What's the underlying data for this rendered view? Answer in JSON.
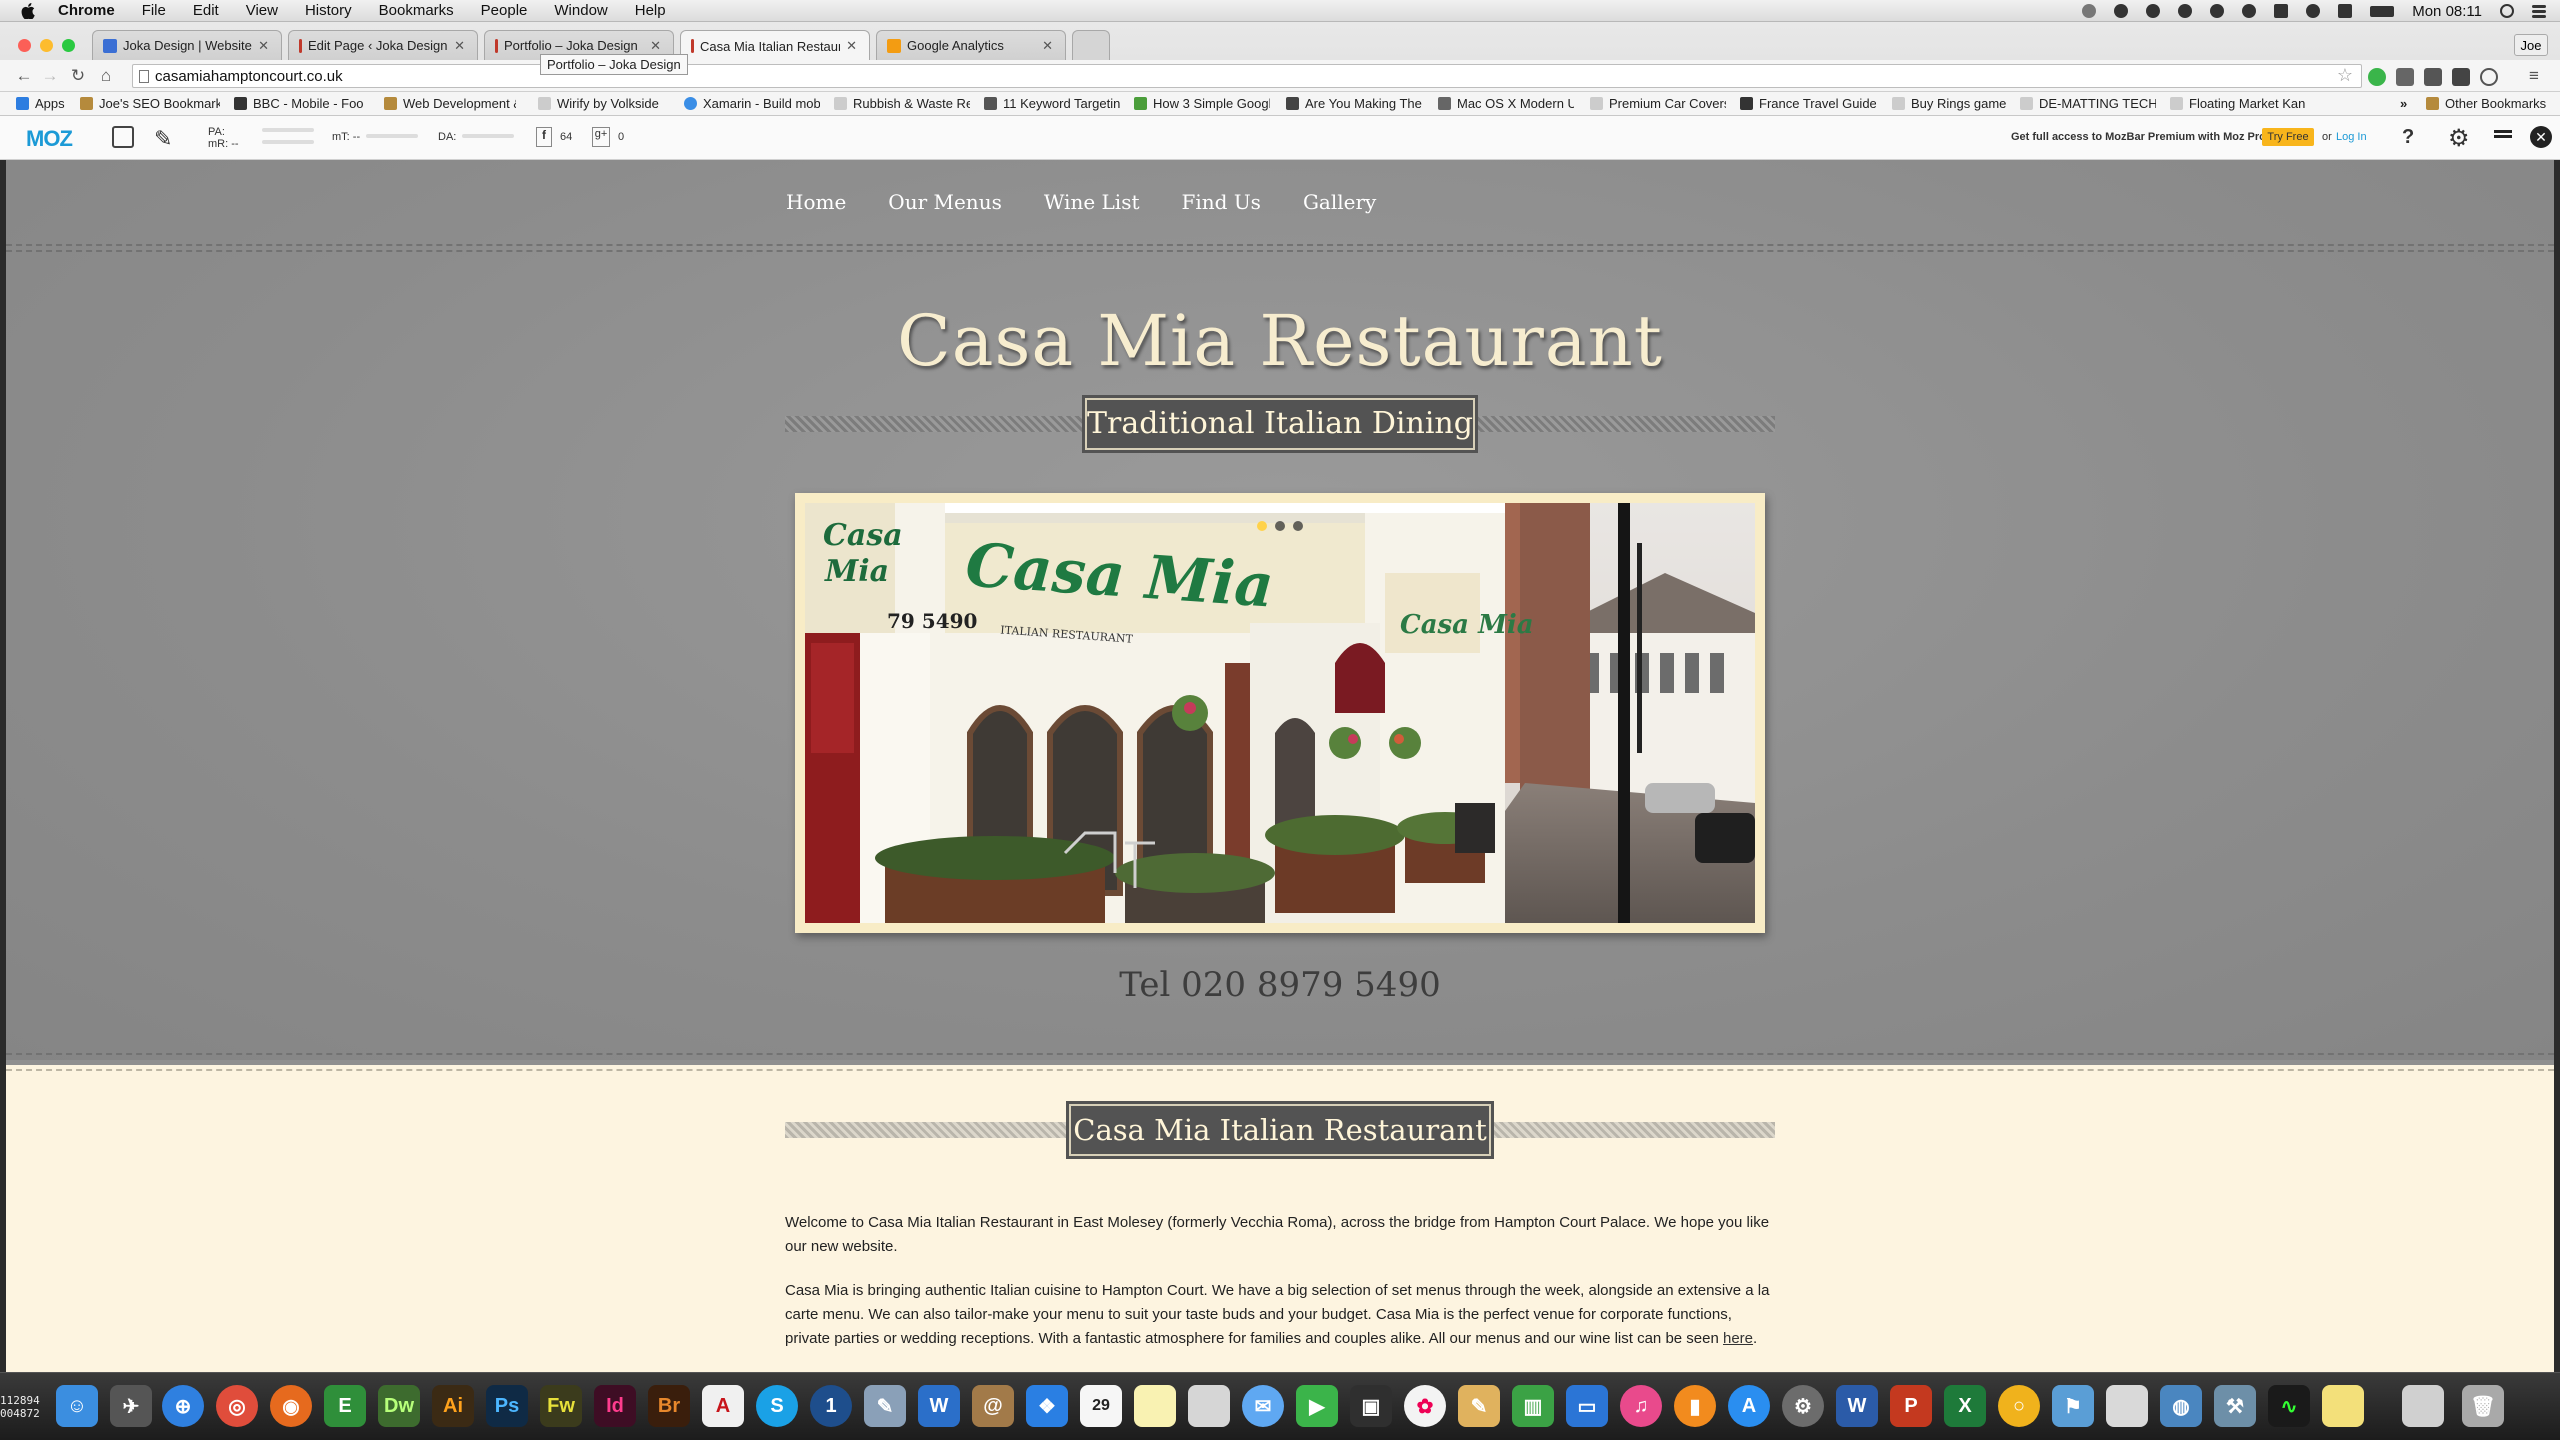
{
  "menubar": {
    "app": "Chrome",
    "items": [
      "File",
      "Edit",
      "View",
      "History",
      "Bookmarks",
      "People",
      "Window",
      "Help"
    ],
    "clock": "Mon 08:11"
  },
  "tabs": [
    {
      "title": "Joka Design | Website Des",
      "fav": "#3b6fd4"
    },
    {
      "title": "Edit Page ‹ Joka Design —",
      "fav": "#c0392b"
    },
    {
      "title": "Portfolio – Joka Design",
      "fav": "#c0392b"
    },
    {
      "title": "Casa Mia Italian Restaurant",
      "fav": "#c0392b"
    },
    {
      "title": "Google Analytics",
      "fav": "#f39c12"
    }
  ],
  "tooltip": "Portfolio – Joka Design",
  "user": "Joe",
  "url": "casamiahamptoncourt.co.uk",
  "bookmarks": [
    "Apps",
    "Joe's SEO Bookmark",
    "BBC - Mobile - Food",
    "Web Development &",
    "Wirify by Volkside",
    "Xamarin - Build mob",
    "Rubbish & Waste Re",
    "11 Keyword Targetin",
    "How 3 Simple Googl",
    "Are You Making The",
    "Mac OS X Modern U",
    "Premium Car Covers",
    "France Travel Guide",
    "Buy Rings game",
    "DE-MATTING TECHN",
    "Floating Market Kan"
  ],
  "other_bookmarks": "Other Bookmarks",
  "mozbar": {
    "logo": "MOZ",
    "pa": "PA:",
    "mr": "mR: --",
    "mt": "mT: --",
    "da": "DA:",
    "fb": "64",
    "gp": "0",
    "promo": "Get full access to MozBar Premium with Moz Pro",
    "try": "Try Free",
    "or": "or",
    "login": "Log In"
  },
  "site": {
    "nav": [
      "Home",
      "Our Menus",
      "Wine List",
      "Find Us",
      "Gallery"
    ],
    "title": "Casa Mia Restaurant",
    "tagline": "Traditional Italian Dining",
    "tel": "Tel 020 8979 5490",
    "section_title": "Casa Mia Italian Restaurant",
    "p1": "Welcome to Casa Mia Italian Restaurant in East Molesey (formerly Vecchia Roma), across the bridge from Hampton Court Palace. We hope you like our new website.",
    "p2": "Casa Mia is bringing authentic Italian cuisine to Hampton Court. We have a big selection of set menus through the week, alongside an extensive a la carte menu. We can also tailor-make your menu to suit your taste buds and your budget. Casa Mia is the perfect venue for corporate functions, private parties or wedding receptions. With a fantastic atmosphere for families and couples alike. All our menus and our wine list can be seen",
    "here": "here",
    "photo": {
      "sign_small": "Casa\nMia",
      "phone_on_wall": "79 5490",
      "sign_big": "Casa Mia",
      "sign_sub": "ITALIAN RESTAURANT"
    }
  },
  "dock_label": "112894\n004872",
  "calendar_day": "29",
  "calendar_month": "FEB"
}
